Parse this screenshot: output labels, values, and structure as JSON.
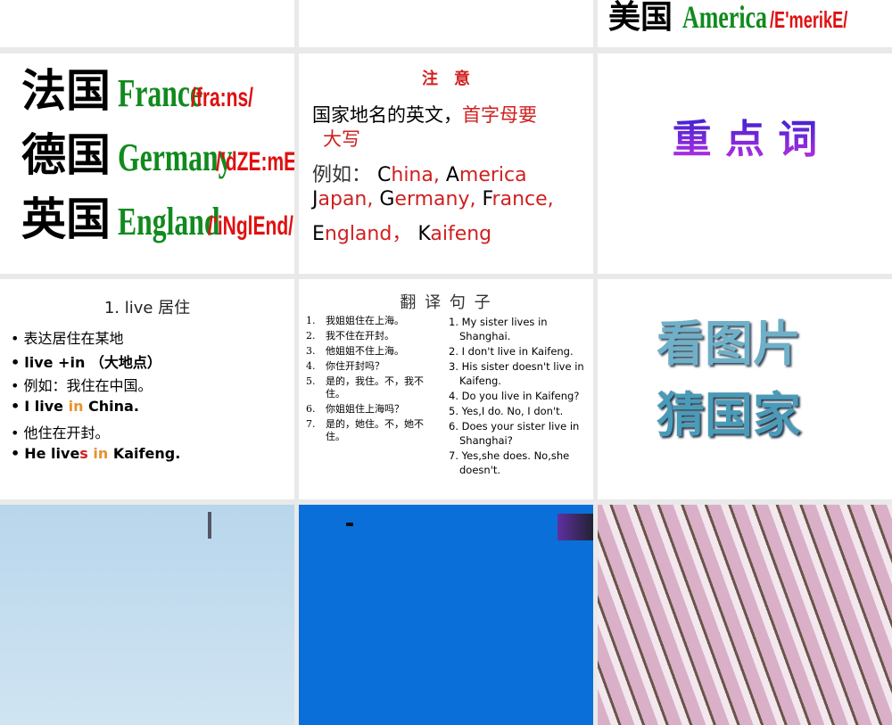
{
  "slides": {
    "america": {
      "cn": "美国",
      "en": "America",
      "ph": "/E'merikE/"
    },
    "countries": [
      {
        "cn": "法国",
        "en": "France",
        "ph": "/fra:ns/"
      },
      {
        "cn": "德国",
        "en": "Germany",
        "ph": "/'dZE:mEni/"
      },
      {
        "cn": "英国",
        "en": "England",
        "ph": "/'iNglEnd/"
      }
    ],
    "note": {
      "title": "注　意",
      "line1a": "国家地名的英文，",
      "line1b": "首字母要",
      "line1c": "大写",
      "lines": [
        [
          [
            "例如： ",
            "k"
          ],
          [
            "C",
            "b"
          ],
          [
            "hina, ",
            "r"
          ],
          [
            "A",
            "b"
          ],
          [
            "merica",
            "r"
          ]
        ],
        [
          [
            "J",
            "b"
          ],
          [
            "apan, ",
            "r"
          ],
          [
            "G",
            "b"
          ],
          [
            "ermany, ",
            "r"
          ],
          [
            "F",
            "b"
          ],
          [
            "rance,",
            "r"
          ]
        ],
        [
          [
            "E",
            "b"
          ],
          [
            "ngland，  ",
            "r"
          ],
          [
            "K",
            "b"
          ],
          [
            "aifeng",
            "r"
          ]
        ]
      ]
    },
    "keywords": {
      "title": "重 点 词"
    },
    "live": {
      "title": "1. live 居住",
      "bullets": [
        [
          [
            "表达居住在某地",
            ""
          ]
        ],
        [
          [
            "live +in （大地点）",
            ""
          ]
        ],
        [
          [
            "例如：我住在中国。",
            ""
          ]
        ],
        [
          [
            "I live ",
            ""
          ],
          [
            "in",
            "org"
          ],
          [
            " China.",
            ""
          ]
        ],
        [
          [
            "他住在开封。",
            ""
          ]
        ],
        [
          [
            "He live",
            ""
          ],
          [
            "s",
            "red"
          ],
          [
            " ",
            ""
          ],
          [
            "in",
            "org"
          ],
          [
            " Kaifeng.",
            ""
          ]
        ]
      ]
    },
    "translate": {
      "title": "翻 译 句 子",
      "cn": [
        "我姐姐住在上海。",
        "我不住在开封。",
        "他姐姐不住上海。",
        "你住开封吗？",
        "是的，我住。不，我不住。",
        "你姐姐住上海吗？",
        "是的，她住。不，她不住。"
      ],
      "en": [
        "1. My sister lives in Shanghai.",
        "2. I don't live in Kaifeng.",
        "3. His sister doesn't live in Kaifeng.",
        "4. Do you live in Kaifeng?",
        "5. Yes,I do.    No, I don't.",
        "6. Does your sister live in Shanghai?",
        "7. Yes,she does. No,she doesn't."
      ]
    },
    "guess": {
      "line1": "看图片",
      "line2": "猜国家"
    }
  }
}
